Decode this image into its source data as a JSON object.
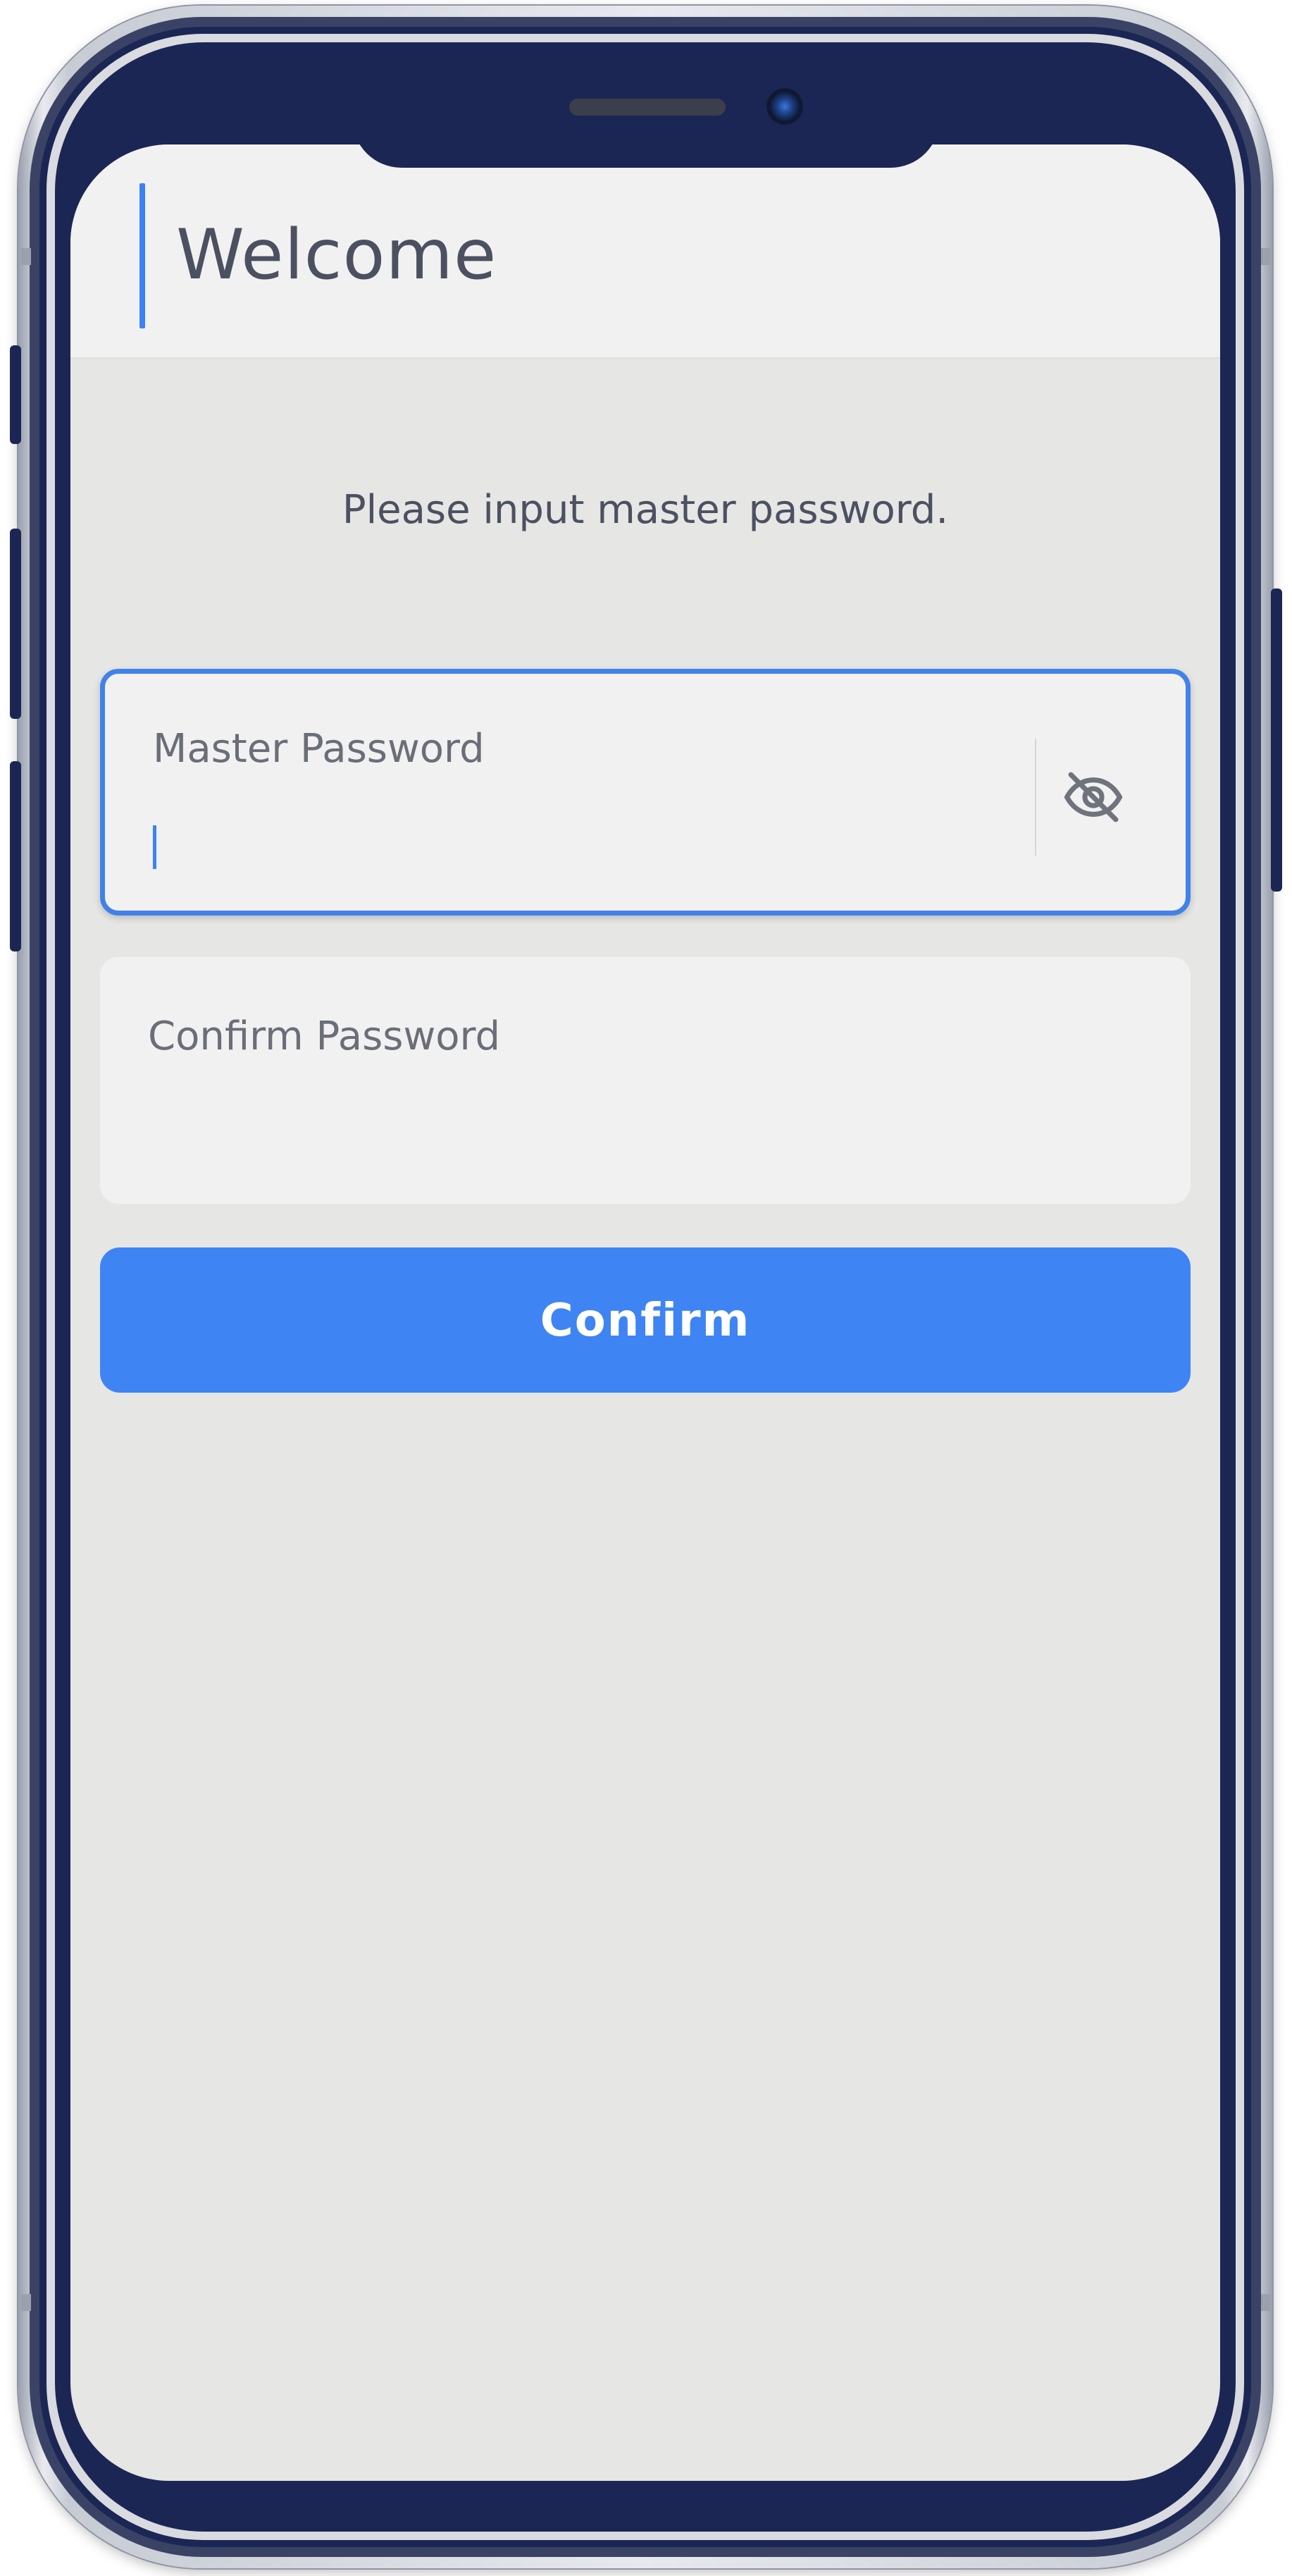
{
  "header": {
    "title": "Welcome"
  },
  "prompt": {
    "text": "Please input master password."
  },
  "fields": {
    "master_password": {
      "label": "Master Password",
      "value": "",
      "visibility_icon": "eye-off-icon"
    },
    "confirm_password": {
      "label": "Confirm Password",
      "value": ""
    }
  },
  "actions": {
    "confirm_label": "Confirm"
  },
  "colors": {
    "accent": "#3e84f3",
    "frame": "#1b2654",
    "background": "#e6e6e5",
    "surface": "#f2f1f2"
  }
}
